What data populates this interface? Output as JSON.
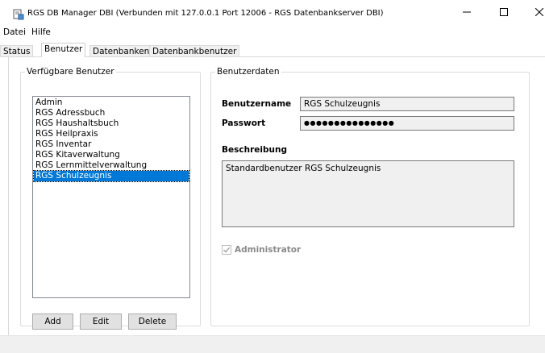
{
  "window": {
    "title": "RGS DB Manager DBI (Verbunden mit 127.0.0.1  Port 12006 - RGS Datenbankserver DBI)",
    "minimize_glyph": "—",
    "maximize_glyph": "☐",
    "close_glyph": "✕"
  },
  "menu": [
    "Datei",
    "Hilfe"
  ],
  "tabs": [
    {
      "label": "Status",
      "active": false
    },
    {
      "label": "Benutzer",
      "active": true
    },
    {
      "label": "Datenbanken",
      "active": false
    },
    {
      "label": "Datenbankbenutzer",
      "active": false
    }
  ],
  "users_panel": {
    "title": "Verfügbare Benutzer",
    "items": [
      "Admin",
      "RGS Adressbuch",
      "RGS Haushaltsbuch",
      "RGS Heilpraxis",
      "RGS Inventar",
      "RGS Kitaverwaltung",
      "RGS Lernmittelverwaltung",
      "RGS Schulzeugnis"
    ],
    "selected_index": 7,
    "add_label": "Add",
    "edit_label": "Edit",
    "delete_label": "Delete"
  },
  "details_panel": {
    "title": "Benutzerdaten",
    "username_label": "Benutzername",
    "username_value": "RGS Schulzeugnis",
    "password_label": "Passwort",
    "password_value": "●●●●●●●●●●●●●●●",
    "description_label": "Beschreibung",
    "description_value": "Standardbenutzer RGS Schulzeugnis",
    "admin_label": "Administrator",
    "admin_checked": true
  },
  "colors": {
    "selection": "#0078d7",
    "disabled_text": "#8a8a8a",
    "statusbar": "#f0f0f0"
  },
  "icons": {
    "app": "database-icon",
    "check": "check-icon"
  }
}
